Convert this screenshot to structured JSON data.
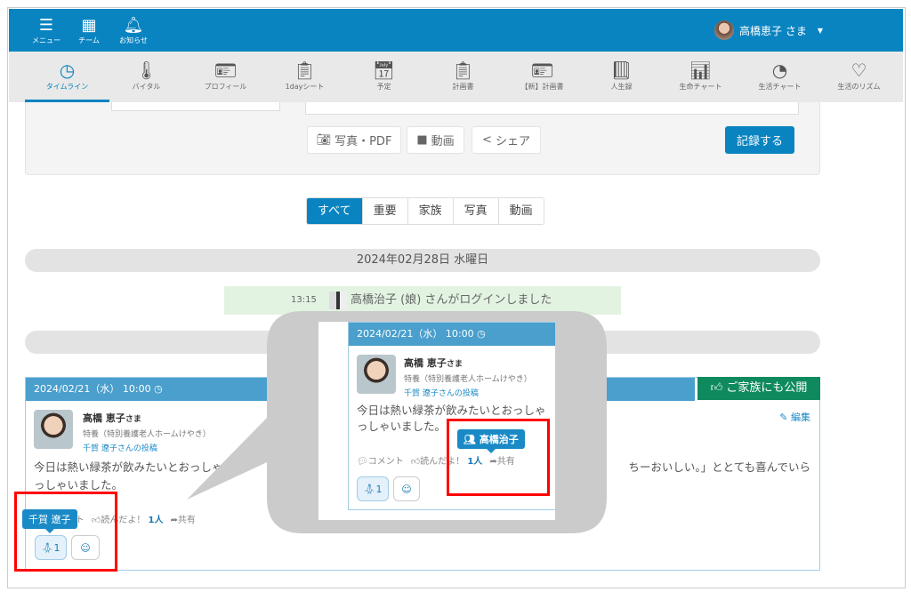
{
  "topbar": {
    "menu": "メニュー",
    "team": "チーム",
    "notice": "お知らせ",
    "user": "高橋恵子 さま"
  },
  "nav": [
    {
      "label": "タイムライン",
      "icon": "clock-icon"
    },
    {
      "label": "バイタル",
      "icon": "thermometer-icon"
    },
    {
      "label": "プロフィール",
      "icon": "id-card-icon"
    },
    {
      "label": "1dayシート",
      "icon": "clipboard-icon"
    },
    {
      "label": "予定",
      "icon": "calendar-icon"
    },
    {
      "label": "計画書",
      "icon": "clipboard-icon"
    },
    {
      "label": "【新】計画書",
      "icon": "badge-icon"
    },
    {
      "label": "人生録",
      "icon": "book-icon"
    },
    {
      "label": "生命チャート",
      "icon": "bar-chart-icon"
    },
    {
      "label": "生活チャート",
      "icon": "pie-chart-icon"
    },
    {
      "label": "生活のリズム",
      "icon": "heartbeat-icon"
    }
  ],
  "form": {
    "photo": "写真・PDF",
    "video": "動画",
    "share": "シェア",
    "submit": "記録する"
  },
  "filters": [
    "すべて",
    "重要",
    "家族",
    "写真",
    "動画"
  ],
  "date_header": "2024年02月28日 水曜日",
  "login_notice": {
    "time": "13:15",
    "text": "高橋治子 (娘) さんがログインしました"
  },
  "post": {
    "datetime": "2024/02/21（水） 10:00",
    "publish": "ご家族にも公開",
    "edit": "編集",
    "name": "高橋 恵子",
    "honorific": "さま",
    "facility": "特養（特別養護老人ホームけやき）",
    "author": "千賀 遼子さんの投稿",
    "body_line1_start": "今日は熱い緑茶が飲みたいとおっしゃ",
    "body_line1_end": "ちーおいしい。」ととても喜んでいら",
    "body_line2": "っしゃいました。",
    "comment": "コメント",
    "read": "読んだよ！",
    "read_count": "1人",
    "share": "共有",
    "reaction_count": "1",
    "tooltip": "千賀 遼子"
  },
  "callout": {
    "datetime": "2024/02/21（水） 10:00",
    "name": "高橋 恵子",
    "honorific": "さま",
    "facility": "特養（特別養護老人ホームけやき）",
    "author": "千賀 遼子さんの投稿",
    "body_line1": "今日は熱い緑茶が飲みたいとおっしゃ",
    "body_line2": "っしゃいました。",
    "tooltip": "高橋治子",
    "comment": "コメント",
    "read": "読んだよ！",
    "read_count": "1人",
    "share": "共有",
    "reaction_count": "1"
  },
  "colors": {
    "brand": "#0a84c1",
    "publish": "#0f8a5f",
    "highlight": "#ff0000"
  }
}
